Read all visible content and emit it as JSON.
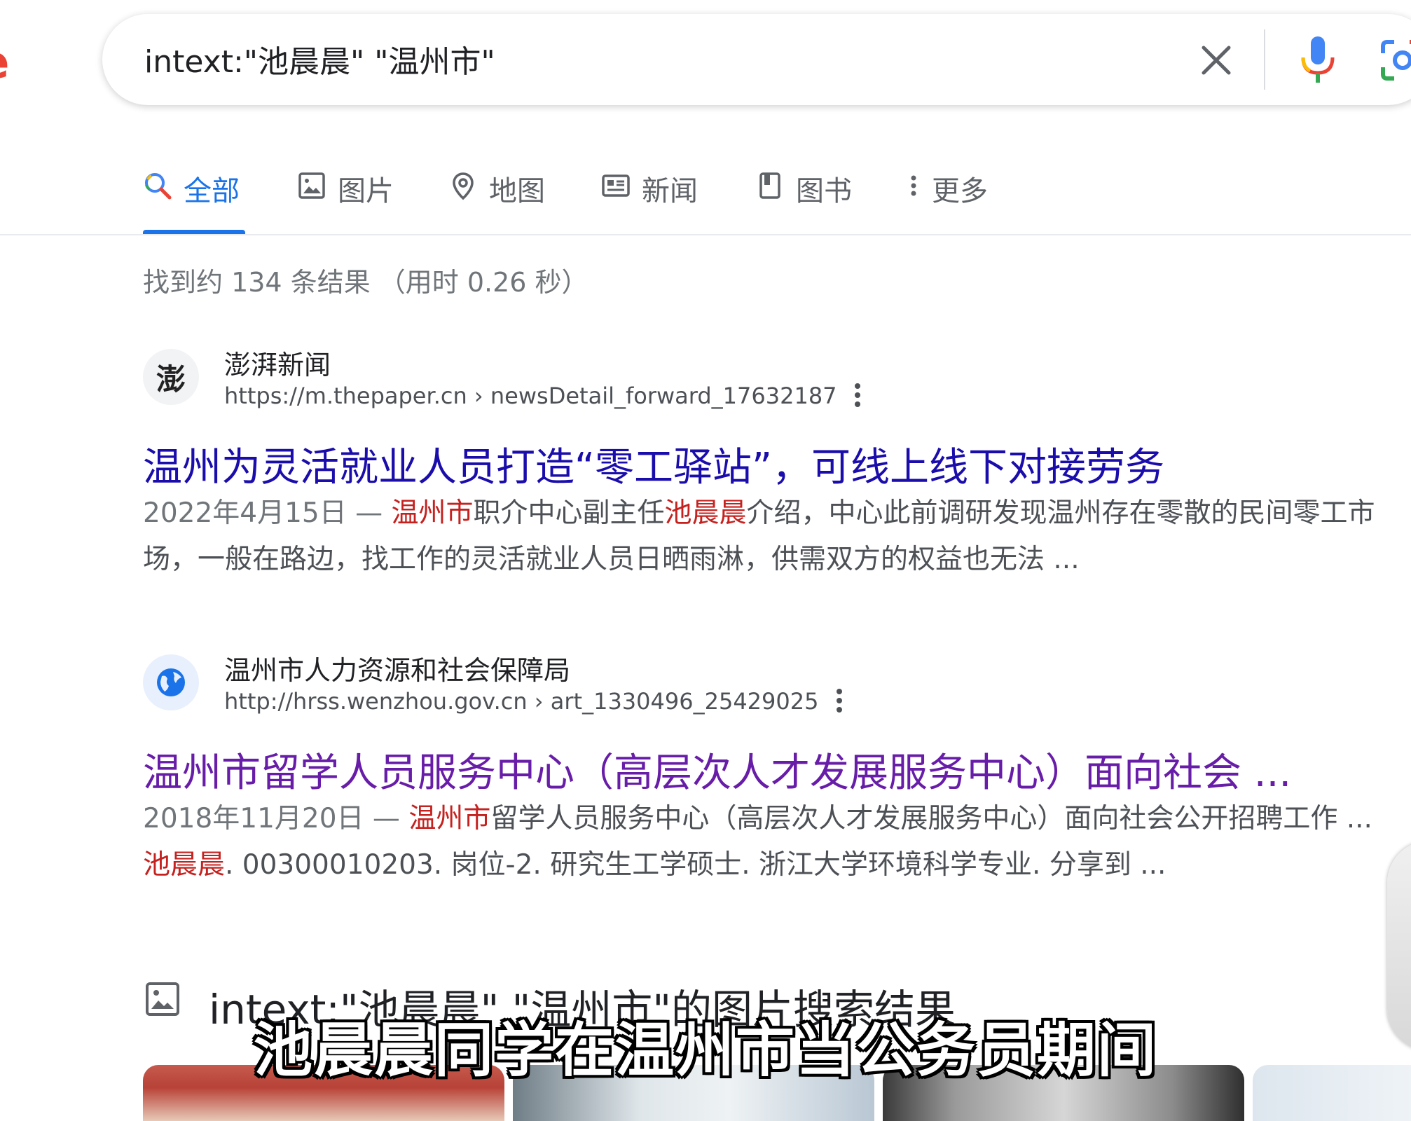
{
  "search": {
    "query": "intext:\"池晨晨\" \"温州市\""
  },
  "tabs": [
    {
      "label": "全部",
      "icon": "search-icon",
      "active": true
    },
    {
      "label": "图片",
      "icon": "image-icon"
    },
    {
      "label": "地图",
      "icon": "map-pin-icon"
    },
    {
      "label": "新闻",
      "icon": "news-icon"
    },
    {
      "label": "图书",
      "icon": "book-icon"
    },
    {
      "label": "更多",
      "icon": "more-vert-icon"
    }
  ],
  "stats": "找到约 134 条结果 （用时 0.26 秒）",
  "results": [
    {
      "site_name": "澎湃新闻",
      "favicon_text": "澎",
      "url": "https://m.thepaper.cn › newsDetail_forward_17632187",
      "title": "温州为灵活就业人员打造“零工驿站”，可线上线下对接劳务",
      "snippet": {
        "date": "2022年4月15日 — ",
        "hl1": "温州市",
        "t1": "职介中心副主任",
        "hl2": "池晨晨",
        "t2": "介绍，中心此前调研发现温州存在零散的民间零工市场，一般在路边，找工作的灵活就业人员日晒雨淋，供需双方的权益也无法 ..."
      }
    },
    {
      "site_name": "温州市人力资源和社会保障局",
      "url": "http://hrss.wenzhou.gov.cn › art_1330496_25429025",
      "title": "温州市留学人员服务中心（高层次人才发展服务中心）面向社会 ...",
      "snippet": {
        "date": "2018年11月20日 — ",
        "hl1": "温州市",
        "t1": "留学人员服务中心（高层次人才发展服务中心）面向社会公开招聘工作 ... ",
        "hl2": "池晨晨",
        "t2": ". 00300010203. 岗位-2. 研究生工学硕士. 浙江大学环境科学专业. 分享到 ..."
      }
    }
  ],
  "image_results": {
    "heading": "intext:\"池晨晨\" \"温州市\"的图片搜索结果"
  },
  "subtitle": "池晨晨同学在温州市当公务员期间",
  "colors": {
    "accent": "#1a73e8",
    "link": "#1a0dab",
    "visited": "#681da8",
    "highlight": "#c5221f"
  }
}
